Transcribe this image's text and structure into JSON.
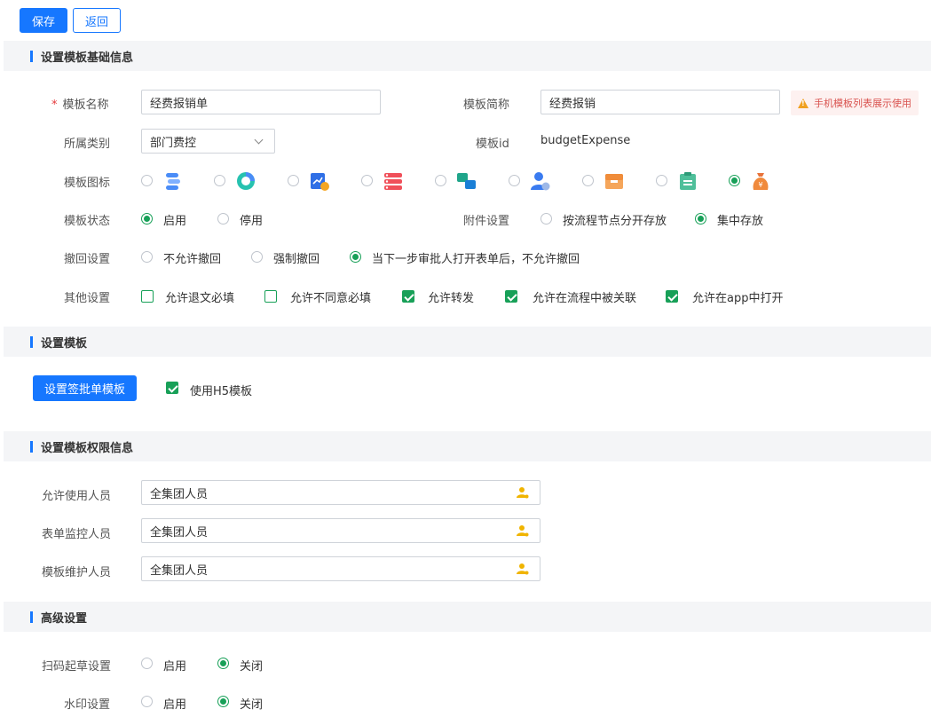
{
  "toolbar": {
    "save_label": "保存",
    "back_label": "返回"
  },
  "basic": {
    "section_title": "设置模板基础信息",
    "name_label": "模板名称",
    "name_value": "经费报销单",
    "short_label": "模板简称",
    "short_value": "经费报销",
    "warning": "手机模板列表展示使用",
    "category_label": "所属类别",
    "category_value": "部门费控",
    "id_label": "模板id",
    "id_value": "budgetExpense",
    "icon_label": "模板图标",
    "status_label": "模板状态",
    "status_enable": "启用",
    "status_disable": "停用",
    "attach_label": "附件设置",
    "attach_by_node": "按流程节点分开存放",
    "attach_central": "集中存放",
    "withdraw_label": "撤回设置",
    "withdraw_options": [
      "不允许撤回",
      "强制撤回",
      "当下一步审批人打开表单后，不允许撤回"
    ],
    "other_label": "其他设置",
    "other_options": [
      "允许退文必填",
      "允许不同意必填",
      "允许转发",
      "允许在流程中被关联",
      "允许在app中打开"
    ]
  },
  "template": {
    "section_title": "设置模板",
    "button_label": "设置签批单模板",
    "h5_label": "使用H5模板"
  },
  "permissions": {
    "section_title": "设置模板权限信息",
    "rows": [
      {
        "label": "允许使用人员",
        "value": "全集团人员"
      },
      {
        "label": "表单监控人员",
        "value": "全集团人员"
      },
      {
        "label": "模板维护人员",
        "value": "全集团人员"
      }
    ]
  },
  "advanced": {
    "section_title": "高级设置",
    "scan_label": "扫码起草设置",
    "watermark_label": "水印设置",
    "enable": "启用",
    "close": "关闭"
  },
  "colors": {
    "primary": "#1677ff",
    "check": "#18a058",
    "warn_text": "#d9534f",
    "section_bg": "#f4f5f7"
  }
}
